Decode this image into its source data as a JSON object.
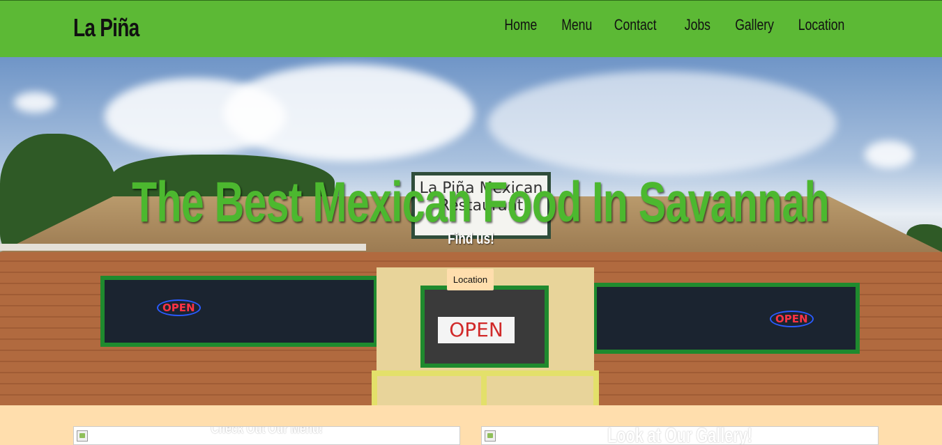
{
  "header": {
    "brand": "La Piña",
    "nav": [
      "Home",
      "Menu",
      "Contact",
      "Jobs",
      "Gallery",
      "Location"
    ]
  },
  "hero": {
    "title": "The Best Mexican Food In Savannah",
    "subtitle": "Find us!",
    "button_label": "Location",
    "photo_signs": {
      "roof_sign": "La Piña Mexican Restaurant",
      "door_sign": "OPEN",
      "neon_left": "OPEN",
      "neon_right": "OPEN"
    }
  },
  "cards": [
    {
      "title": "Check Out Our Menu!"
    },
    {
      "title": "Look at Our Gallery!"
    }
  ],
  "colors": {
    "header_bg": "#5cb935",
    "accent_green": "#4cb82f",
    "page_bg": "#ffdead"
  }
}
